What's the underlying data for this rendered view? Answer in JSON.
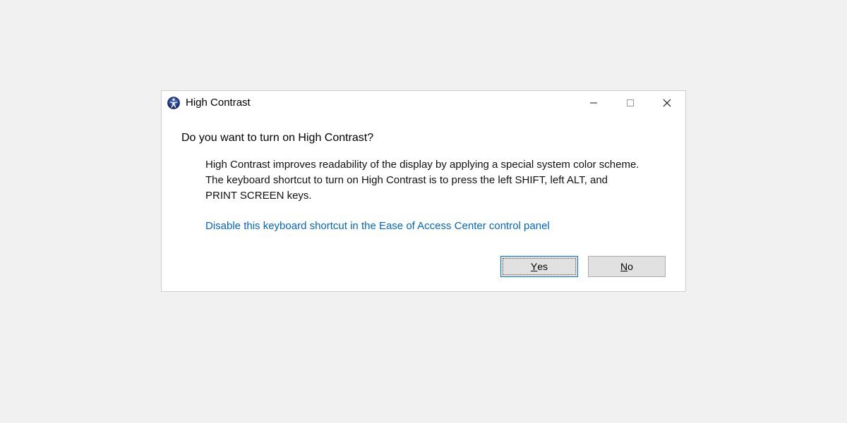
{
  "titlebar": {
    "title": "High Contrast"
  },
  "content": {
    "main_instruction": "Do you want to turn on High Contrast?",
    "body": "High Contrast improves readability of the display by applying a special system color scheme.  The keyboard shortcut to turn on High Contrast is to press the left SHIFT, left ALT, and PRINT SCREEN keys.",
    "link": "Disable this keyboard shortcut in the Ease of Access Center control panel"
  },
  "buttons": {
    "yes_pre": "",
    "yes_accel": "Y",
    "yes_post": "es",
    "no_pre": "",
    "no_accel": "N",
    "no_post": "o"
  }
}
